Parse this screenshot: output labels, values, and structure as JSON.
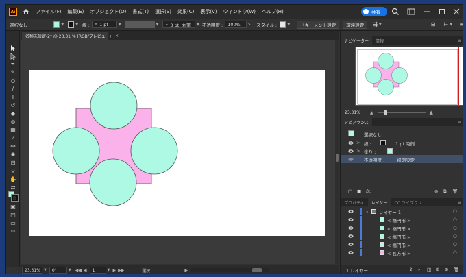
{
  "app": {
    "logo": "Ai"
  },
  "menu": [
    "ファイル(F)",
    "編集(E)",
    "オブジェクト(O)",
    "書式(T)",
    "選択(S)",
    "効果(C)",
    "表示(V)",
    "ウィンドウ(W)",
    "ヘルプ(H)"
  ],
  "share": {
    "label": "共有"
  },
  "controlbar": {
    "selection": "選択なし",
    "stroke_label": "線 :",
    "stroke_weight": "1 pt",
    "brush": "3 pt. 丸筆",
    "opacity_label": "不透明度 :",
    "opacity_value": "100%",
    "style_label": "スタイル :",
    "doc_setup": "ドキュメント設定",
    "prefs": "環境設定"
  },
  "document": {
    "tab_title": "名称未設定-2* @ 23.31 % (RGB/プレビュー)",
    "close": "×"
  },
  "status": {
    "zoom": "23.31%",
    "rotate": "0°",
    "artboard": "1",
    "tool": "選択"
  },
  "colors": {
    "circle_fill": "#aef9e4",
    "rect_fill": "#fbb2eb",
    "stroke": "#555555",
    "accent": "#1473e6"
  },
  "navigator": {
    "tabs": [
      "ナビゲーター",
      "情報"
    ],
    "zoom": "23.31%"
  },
  "appearance": {
    "title": "アピアランス",
    "selection": "選択なし",
    "stroke_label": "線 :",
    "stroke_value": "1 pt 内側",
    "fill_label": "塗り :",
    "opacity_label": "不透明度 :",
    "opacity_value": "初期設定"
  },
  "layers_panel": {
    "tabs": [
      "プロパティ",
      "レイヤー",
      "CC ライブラリ"
    ],
    "layer_name": "レイヤー 1",
    "items": [
      {
        "label": "< 楕円形 >",
        "color": "#aef9e4"
      },
      {
        "label": "< 楕円形 >",
        "color": "#aef9e4"
      },
      {
        "label": "< 楕円形 >",
        "color": "#aef9e4"
      },
      {
        "label": "< 楕円形 >",
        "color": "#aef9e4"
      },
      {
        "label": "< 長方形 >",
        "color": "#fbb2eb"
      }
    ],
    "footer": "1 レイヤー"
  }
}
